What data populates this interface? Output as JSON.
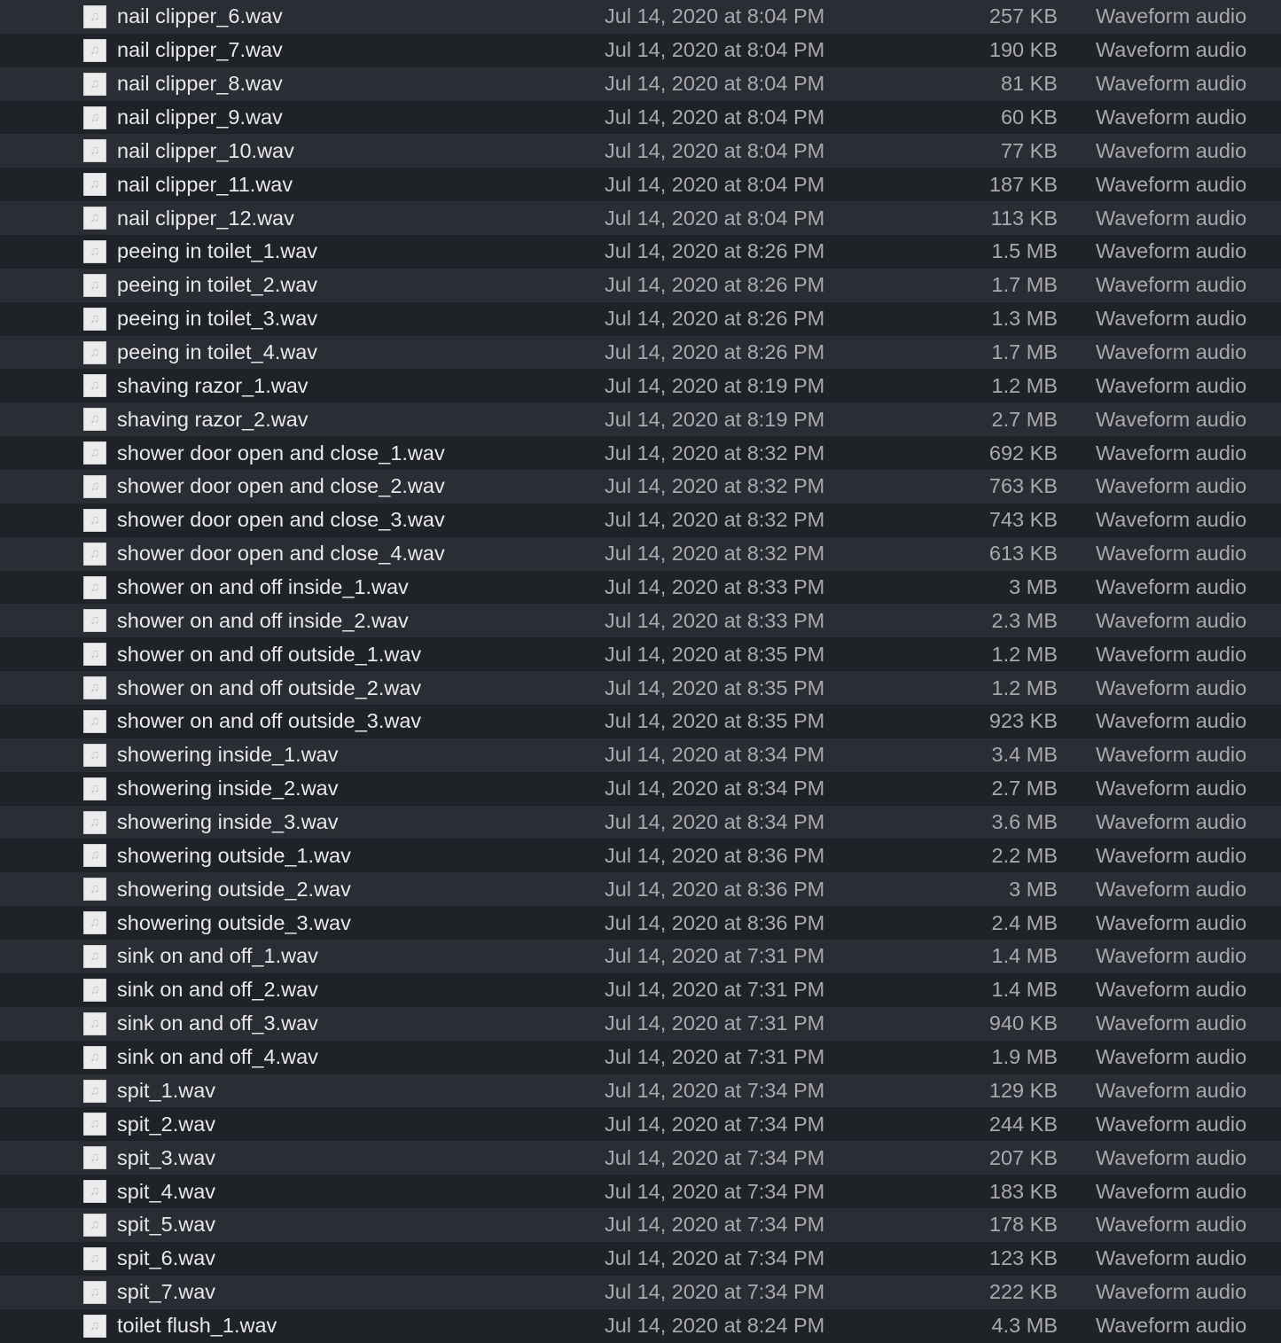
{
  "icons": {
    "file": "audio-file-icon"
  },
  "colors": {
    "row_odd": "#2a2d33",
    "row_even": "#1f2227",
    "name_text": "#e8e8e8",
    "meta_text": "#a9a9ab"
  },
  "files": [
    {
      "name": "nail clipper_6.wav",
      "date": "Jul 14, 2020 at 8:04 PM",
      "size": "257 KB",
      "kind": "Waveform audio"
    },
    {
      "name": "nail clipper_7.wav",
      "date": "Jul 14, 2020 at 8:04 PM",
      "size": "190 KB",
      "kind": "Waveform audio"
    },
    {
      "name": "nail clipper_8.wav",
      "date": "Jul 14, 2020 at 8:04 PM",
      "size": "81 KB",
      "kind": "Waveform audio"
    },
    {
      "name": "nail clipper_9.wav",
      "date": "Jul 14, 2020 at 8:04 PM",
      "size": "60 KB",
      "kind": "Waveform audio"
    },
    {
      "name": "nail clipper_10.wav",
      "date": "Jul 14, 2020 at 8:04 PM",
      "size": "77 KB",
      "kind": "Waveform audio"
    },
    {
      "name": "nail clipper_11.wav",
      "date": "Jul 14, 2020 at 8:04 PM",
      "size": "187 KB",
      "kind": "Waveform audio"
    },
    {
      "name": "nail clipper_12.wav",
      "date": "Jul 14, 2020 at 8:04 PM",
      "size": "113 KB",
      "kind": "Waveform audio"
    },
    {
      "name": "peeing in toilet_1.wav",
      "date": "Jul 14, 2020 at 8:26 PM",
      "size": "1.5 MB",
      "kind": "Waveform audio"
    },
    {
      "name": "peeing in toilet_2.wav",
      "date": "Jul 14, 2020 at 8:26 PM",
      "size": "1.7 MB",
      "kind": "Waveform audio"
    },
    {
      "name": "peeing in toilet_3.wav",
      "date": "Jul 14, 2020 at 8:26 PM",
      "size": "1.3 MB",
      "kind": "Waveform audio"
    },
    {
      "name": "peeing in toilet_4.wav",
      "date": "Jul 14, 2020 at 8:26 PM",
      "size": "1.7 MB",
      "kind": "Waveform audio"
    },
    {
      "name": "shaving razor_1.wav",
      "date": "Jul 14, 2020 at 8:19 PM",
      "size": "1.2 MB",
      "kind": "Waveform audio"
    },
    {
      "name": "shaving razor_2.wav",
      "date": "Jul 14, 2020 at 8:19 PM",
      "size": "2.7 MB",
      "kind": "Waveform audio"
    },
    {
      "name": "shower door open and close_1.wav",
      "date": "Jul 14, 2020 at 8:32 PM",
      "size": "692 KB",
      "kind": "Waveform audio"
    },
    {
      "name": "shower door open and close_2.wav",
      "date": "Jul 14, 2020 at 8:32 PM",
      "size": "763 KB",
      "kind": "Waveform audio"
    },
    {
      "name": "shower door open and close_3.wav",
      "date": "Jul 14, 2020 at 8:32 PM",
      "size": "743 KB",
      "kind": "Waveform audio"
    },
    {
      "name": "shower door open and close_4.wav",
      "date": "Jul 14, 2020 at 8:32 PM",
      "size": "613 KB",
      "kind": "Waveform audio"
    },
    {
      "name": "shower on and off inside_1.wav",
      "date": "Jul 14, 2020 at 8:33 PM",
      "size": "3 MB",
      "kind": "Waveform audio"
    },
    {
      "name": "shower on and off inside_2.wav",
      "date": "Jul 14, 2020 at 8:33 PM",
      "size": "2.3 MB",
      "kind": "Waveform audio"
    },
    {
      "name": "shower on and off outside_1.wav",
      "date": "Jul 14, 2020 at 8:35 PM",
      "size": "1.2 MB",
      "kind": "Waveform audio"
    },
    {
      "name": "shower on and off outside_2.wav",
      "date": "Jul 14, 2020 at 8:35 PM",
      "size": "1.2 MB",
      "kind": "Waveform audio"
    },
    {
      "name": "shower on and off outside_3.wav",
      "date": "Jul 14, 2020 at 8:35 PM",
      "size": "923 KB",
      "kind": "Waveform audio"
    },
    {
      "name": "showering inside_1.wav",
      "date": "Jul 14, 2020 at 8:34 PM",
      "size": "3.4 MB",
      "kind": "Waveform audio"
    },
    {
      "name": "showering inside_2.wav",
      "date": "Jul 14, 2020 at 8:34 PM",
      "size": "2.7 MB",
      "kind": "Waveform audio"
    },
    {
      "name": "showering inside_3.wav",
      "date": "Jul 14, 2020 at 8:34 PM",
      "size": "3.6 MB",
      "kind": "Waveform audio"
    },
    {
      "name": "showering outside_1.wav",
      "date": "Jul 14, 2020 at 8:36 PM",
      "size": "2.2 MB",
      "kind": "Waveform audio"
    },
    {
      "name": "showering outside_2.wav",
      "date": "Jul 14, 2020 at 8:36 PM",
      "size": "3 MB",
      "kind": "Waveform audio"
    },
    {
      "name": "showering outside_3.wav",
      "date": "Jul 14, 2020 at 8:36 PM",
      "size": "2.4 MB",
      "kind": "Waveform audio"
    },
    {
      "name": "sink on and off_1.wav",
      "date": "Jul 14, 2020 at 7:31 PM",
      "size": "1.4 MB",
      "kind": "Waveform audio"
    },
    {
      "name": "sink on and off_2.wav",
      "date": "Jul 14, 2020 at 7:31 PM",
      "size": "1.4 MB",
      "kind": "Waveform audio"
    },
    {
      "name": "sink on and off_3.wav",
      "date": "Jul 14, 2020 at 7:31 PM",
      "size": "940 KB",
      "kind": "Waveform audio"
    },
    {
      "name": "sink on and off_4.wav",
      "date": "Jul 14, 2020 at 7:31 PM",
      "size": "1.9 MB",
      "kind": "Waveform audio"
    },
    {
      "name": "spit_1.wav",
      "date": "Jul 14, 2020 at 7:34 PM",
      "size": "129 KB",
      "kind": "Waveform audio"
    },
    {
      "name": "spit_2.wav",
      "date": "Jul 14, 2020 at 7:34 PM",
      "size": "244 KB",
      "kind": "Waveform audio"
    },
    {
      "name": "spit_3.wav",
      "date": "Jul 14, 2020 at 7:34 PM",
      "size": "207 KB",
      "kind": "Waveform audio"
    },
    {
      "name": "spit_4.wav",
      "date": "Jul 14, 2020 at 7:34 PM",
      "size": "183 KB",
      "kind": "Waveform audio"
    },
    {
      "name": "spit_5.wav",
      "date": "Jul 14, 2020 at 7:34 PM",
      "size": "178 KB",
      "kind": "Waveform audio"
    },
    {
      "name": "spit_6.wav",
      "date": "Jul 14, 2020 at 7:34 PM",
      "size": "123 KB",
      "kind": "Waveform audio"
    },
    {
      "name": "spit_7.wav",
      "date": "Jul 14, 2020 at 7:34 PM",
      "size": "222 KB",
      "kind": "Waveform audio"
    },
    {
      "name": "toilet flush_1.wav",
      "date": "Jul 14, 2020 at 8:24 PM",
      "size": "4.3 MB",
      "kind": "Waveform audio"
    }
  ]
}
